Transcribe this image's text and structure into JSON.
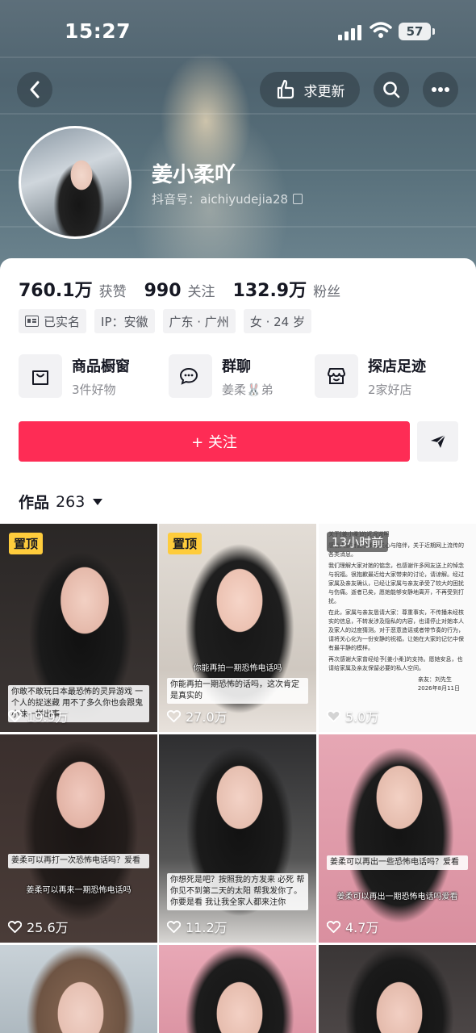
{
  "status_bar": {
    "time": "15:27",
    "battery": "57"
  },
  "nav": {
    "request_update_label": "求更新"
  },
  "profile": {
    "name": "姜小柔吖",
    "douyin_id": "抖音号：aichiyudejia28"
  },
  "stats": [
    {
      "value": "760.1万",
      "label": "获赞"
    },
    {
      "value": "990",
      "label": "关注"
    },
    {
      "value": "132.9万",
      "label": "粉丝"
    }
  ],
  "tags": [
    {
      "text": "已实名"
    },
    {
      "text": "IP：安徽"
    },
    {
      "text": "广东 · 广州"
    },
    {
      "text": "女 · 24 岁"
    }
  ],
  "features": [
    {
      "title": "商品橱窗",
      "subtitle": "3件好物",
      "icon": "bag-icon"
    },
    {
      "title": "群聊",
      "subtitle": "姜柔🐰弟",
      "icon": "chat-icon"
    },
    {
      "title": "探店足迹",
      "subtitle": "2家好店",
      "icon": "shop-icon"
    }
  ],
  "follow_label": "+ 关注",
  "works": {
    "label": "作品",
    "count": "263"
  },
  "videos": [
    {
      "pinned_label": "置顶",
      "likes": "19.9万",
      "caption": "你敢不敢玩日本最恐怖的灵异游戏 一个人的捉迷藏 用不了多久你也会跟鬼小妹一样出事"
    },
    {
      "pinned_label": "置顶",
      "likes": "27.0万",
      "caption_top": "你能再拍一期恐怖电话吗",
      "caption": "你能再拍一期恐怖的话吗，这次肯定是真实的"
    },
    {
      "time_label": "13小时前",
      "likes": "5.0万",
      "doc_title": "关于[姜小柔]的近况说明",
      "doc_lines": [
        "感谢大家对姜小柔的关心与陪伴，关于近期网上流传的各类消息。",
        "我们理解大家对她的惦念，也感谢许多网友送上的悼念与祝福。很抱歉最近给大家带来的讨论，请谅解。经过家属及亲友确认，已经让家属与亲友承受了较大的困扰与伤痛。逝者已矣，愿她能够安静地离开，不再受到打扰。",
        "在此，家属与亲友恳请大家：尊重事实，不传播未经核实的信息，不转发涉及隐私的内容，也请停止对她本人及家人的过度猜测。对于恶意造谣或者带节奏的行为，请将关心化为一份安静的祝福，让她在大家的记忆中保有最平静的模样。",
        "再次感谢大家曾经给予[姜小柔]的支持。愿她安息，也请给家属及亲友保留必要的私人空间。"
      ],
      "doc_sign": "亲友：刘先生",
      "doc_date": "2026年8月11日"
    },
    {
      "likes": "25.6万",
      "caption": "姜柔可以再打一次恐怖电话吗？爱看",
      "caption_bottom": "姜柔可以再来一期恐怖电话吗"
    },
    {
      "likes": "11.2万",
      "caption": "你想死是吧？按照我的方发来 必死 帮你见不到第二天的太阳 帮我发你了。你要是看 我让我全家人都来注你"
    },
    {
      "likes": "4.7万",
      "caption": "姜柔可以再出一些恐怖电话吗？爱看",
      "caption_bottom": "姜柔可以再出一期恐怖电话吗爱看"
    },
    {},
    {},
    {}
  ]
}
